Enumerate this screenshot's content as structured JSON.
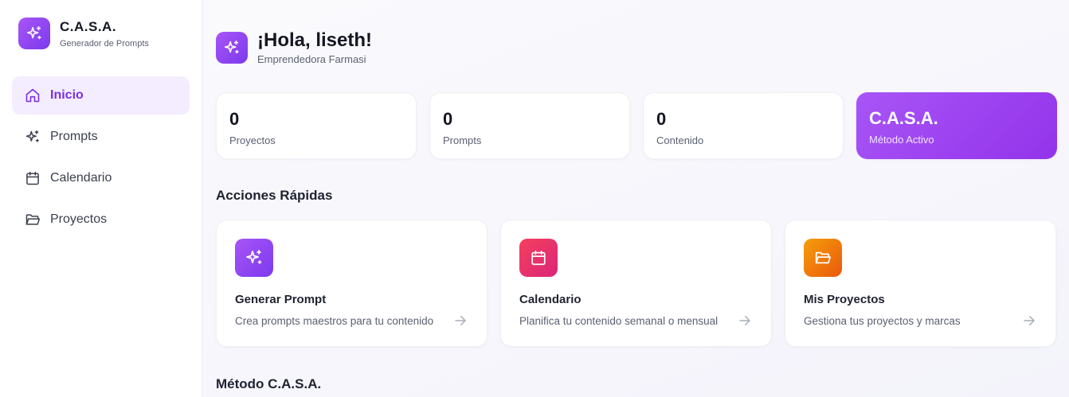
{
  "sidebar": {
    "brand": {
      "title": "C.A.S.A.",
      "subtitle": "Generador de Prompts",
      "icon": "sparkles-icon"
    },
    "items": [
      {
        "label": "Inicio",
        "icon": "home-icon",
        "active": true
      },
      {
        "label": "Prompts",
        "icon": "sparkles-icon",
        "active": false
      },
      {
        "label": "Calendario",
        "icon": "calendar-icon",
        "active": false
      },
      {
        "label": "Proyectos",
        "icon": "folder-icon",
        "active": false
      }
    ]
  },
  "header": {
    "title": "¡Hola, liseth!",
    "subtitle": "Emprendedora Farmasi",
    "icon": "sparkles-icon"
  },
  "stats": [
    {
      "value": "0",
      "label": "Proyectos"
    },
    {
      "value": "0",
      "label": "Prompts"
    },
    {
      "value": "0",
      "label": "Contenido"
    },
    {
      "value": "C.A.S.A.",
      "label": "Método Activo"
    }
  ],
  "quick_actions": {
    "title": "Acciones Rápidas",
    "items": [
      {
        "title": "Generar Prompt",
        "description": "Crea prompts maestros para tu contenido",
        "icon": "sparkles-icon",
        "color_from": "#a855f7",
        "color_to": "#7c3aed"
      },
      {
        "title": "Calendario",
        "description": "Planifica tu contenido semanal o mensual",
        "icon": "calendar-icon",
        "color_from": "#f43f5e",
        "color_to": "#db2777"
      },
      {
        "title": "Mis Proyectos",
        "description": "Gestiona tus proyectos y marcas",
        "icon": "folder-icon",
        "color_from": "#f59e0b",
        "color_to": "#ea580c"
      }
    ]
  },
  "method_section": {
    "title": "Método C.A.S.A."
  },
  "colors": {
    "accent": "#9333ea",
    "active_bg": "#f3edff",
    "active_text": "#7c2fe0"
  }
}
